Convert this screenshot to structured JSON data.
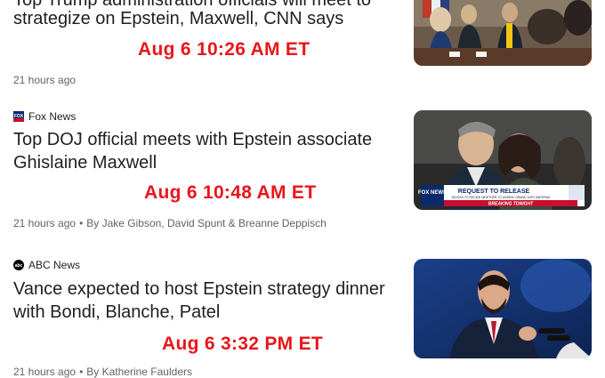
{
  "articles": [
    {
      "headline_line1": "Top Trump administration officials will meet to",
      "headline_line2": "strategize on Epstein, Maxwell, CNN says",
      "stamp": "Aug 6 10:26 AM ET",
      "time": "21 hours ago",
      "thumbnail_icon": "cabinet-meeting-photo"
    },
    {
      "source": "Fox News",
      "headline_line1": "Top DOJ official meets with Epstein associate",
      "headline_line2": "Ghislaine Maxwell",
      "stamp": "Aug 6 10:48 AM ET",
      "time": "21 hours ago",
      "byline": "By Jake Gibson, David Spunt & Breanne Deppisch",
      "thumbnail_icon": "epstein-maxwell-photo",
      "thumb_banner": "REQUEST TO RELEASE",
      "thumb_banner_sub": "JUDGES TO DECIDE WHETHER TO UNSEAL GRAND JURY MATERIAL",
      "thumb_breaking": "BREAKING TONIGHT",
      "thumb_logo": "FOX NEWS"
    },
    {
      "source": "ABC News",
      "headline_line1": "Vance expected to host Epstein strategy dinner",
      "headline_line2": "with Bondi, Blanche, Patel",
      "stamp": "Aug 6 3:32 PM ET",
      "time": "21 hours ago",
      "byline": "By Katherine Faulders",
      "thumbnail_icon": "vance-speaking-photo",
      "abc_logo": "abc"
    }
  ],
  "separator": "•",
  "colors": {
    "stamp": "#e8161c",
    "meta": "#5f6368",
    "text": "#1f1f1f"
  }
}
